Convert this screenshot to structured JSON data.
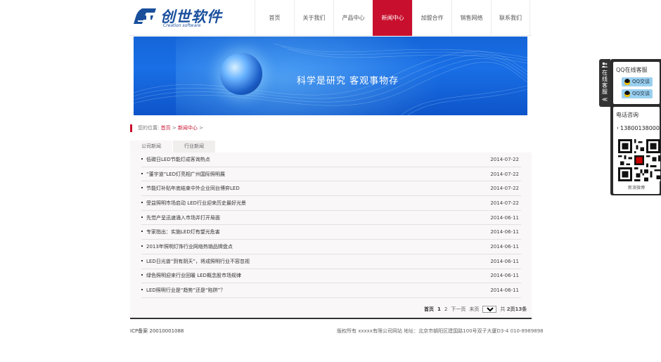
{
  "brand": {
    "name_cn": "创世软件",
    "name_en": "Creation software",
    "color": "#1a4f9c"
  },
  "nav": {
    "items": [
      {
        "label": "首页"
      },
      {
        "label": "关于我们"
      },
      {
        "label": "产品中心"
      },
      {
        "label": "新闻中心",
        "active": true
      },
      {
        "label": "加盟合作"
      },
      {
        "label": "销售网络"
      },
      {
        "label": "联系我们"
      }
    ],
    "active_color": "#c8102e"
  },
  "banner": {
    "slogan": "科学是研究  客观事物存"
  },
  "breadcrumb": {
    "prefix": "您的位置:",
    "home": "首页",
    "sep": ">",
    "current": "新闻中心",
    "trail": ">"
  },
  "tabs": [
    {
      "label": "公司新闻",
      "active": true
    },
    {
      "label": "行业新闻"
    }
  ],
  "news": [
    {
      "title": "低碳日LED节能灯成客询热点",
      "date": "2014-07-22"
    },
    {
      "title": "“蓬宇道”LED灯亮相广州国际照明展",
      "date": "2014-07-22"
    },
    {
      "title": "节能灯补贴年底结束中外企业同台博弈LED",
      "date": "2014-07-22"
    },
    {
      "title": "受益照明市场启动 LED行业迎来历史最好光景",
      "date": "2014-07-22"
    },
    {
      "title": "先觉产呈迅速涌入市场并打开局面",
      "date": "2014-06-11"
    },
    {
      "title": "专家指出：实施LED灯有望光危害",
      "date": "2014-06-11"
    },
    {
      "title": "2013年照明灯饰行业网络热销品牌盘点",
      "date": "2014-06-11"
    },
    {
      "title": "LED日光兽“到有阴天”，将成照明行业不容忽视",
      "date": "2014-06-11"
    },
    {
      "title": "绿色照明迎来行业回暖 LED概念股市场规律",
      "date": "2014-06-11"
    },
    {
      "title": "LED照明行业是“趋势”还是“陷阱”？",
      "date": "2014-06-11"
    }
  ],
  "pager": {
    "first": "首页",
    "current": "1",
    "page2": "2",
    "next": "下一页",
    "last": "末页",
    "select_value": "1",
    "total_prefix": "共",
    "total_pages": "2页",
    "total_items": "13条"
  },
  "footer": {
    "icp": "ICP备案 20010001088",
    "copyright": "版权所有 xxxxx有限公司网站 地址：北京市朝阳区建国路100号双子大厦D3-4 010-8989898"
  },
  "side": {
    "tab_text": "在线客服",
    "collapse": "≪",
    "qq_title": "QQ在线客服",
    "qq_buttons": [
      "QQ交谈",
      "QQ交谈"
    ],
    "phone_title": "电话咨询",
    "phone": "13800138000",
    "weibo": "新浪微博"
  }
}
